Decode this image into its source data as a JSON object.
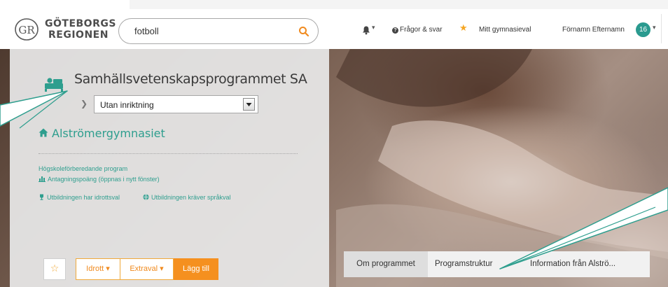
{
  "header": {
    "logo_line1": "GÖTEBORGS",
    "logo_line2": "REGIONEN",
    "logo_mark": "GR",
    "search_value": "fotboll",
    "faq_label": "Frågor & svar",
    "favorites_label": "Mitt gymnasieval",
    "user_name": "Förnamn Efternamn",
    "user_badge": "16",
    "caret": "▾",
    "faq_mark": "?"
  },
  "program": {
    "title": "Samhällsvetenskapsprogrammet SA",
    "inriktning": "Utan inriktning",
    "school": "Alströmergymnasiet",
    "type": "Högskoleförberedande program",
    "antagning": "Antagningspoäng (öppnas i nytt fönster)",
    "idrott_info": "Utbildningen har idrottsval",
    "sprak_info": "Utbildningen kräver språkval"
  },
  "actions": {
    "favorite_symbol": "☆",
    "idrott_label": "Idrott ▾",
    "extraval_label": "Extraval ▾",
    "add_label": "Lägg till"
  },
  "tabs": [
    {
      "label": "Om programmet"
    },
    {
      "label": "Programstruktur"
    },
    {
      "label": "Information från Alströ..."
    }
  ],
  "colors": {
    "accent_teal": "#2e9e8e",
    "accent_orange": "#f5901f",
    "star": "#f5a623",
    "badge": "#2a9a8f"
  },
  "icons": [
    "search-icon",
    "bell-icon",
    "question-icon",
    "star-icon",
    "program-icon",
    "chevron-right-icon",
    "home-icon",
    "bar-chart-icon",
    "trophy-icon",
    "globe-icon"
  ]
}
